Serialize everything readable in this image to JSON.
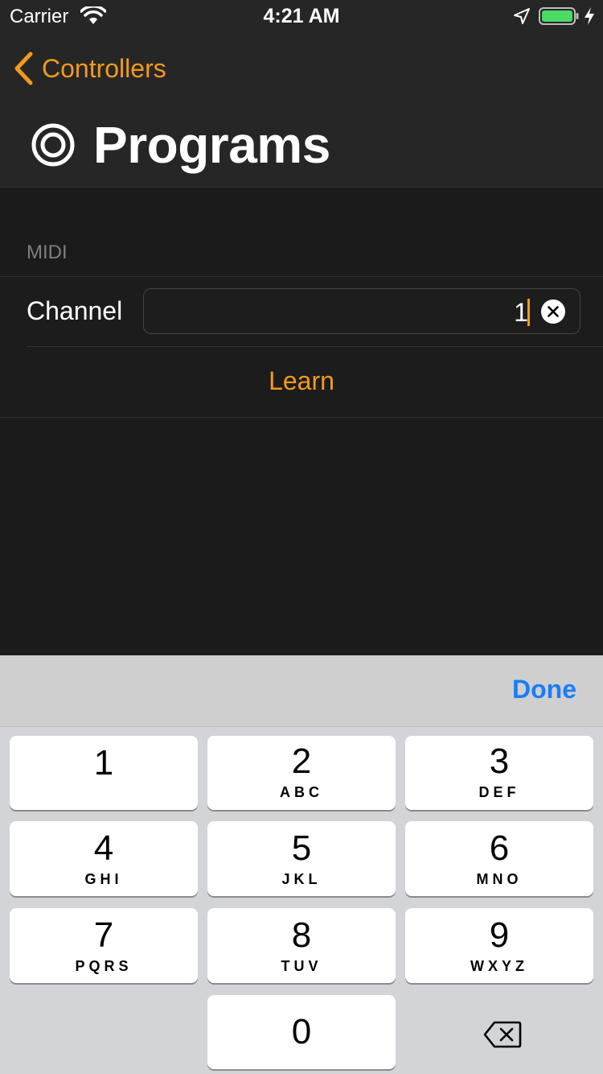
{
  "status_bar": {
    "carrier": "Carrier",
    "time": "4:21 AM"
  },
  "nav": {
    "back_label": "Controllers",
    "title": "Programs"
  },
  "section": {
    "header": "MIDI"
  },
  "channel": {
    "label": "Channel",
    "value": "1"
  },
  "learn_label": "Learn",
  "keyboard": {
    "done_label": "Done",
    "keys": [
      {
        "num": "1",
        "letters": ""
      },
      {
        "num": "2",
        "letters": "ABC"
      },
      {
        "num": "3",
        "letters": "DEF"
      },
      {
        "num": "4",
        "letters": "GHI"
      },
      {
        "num": "5",
        "letters": "JKL"
      },
      {
        "num": "6",
        "letters": "MNO"
      },
      {
        "num": "7",
        "letters": "PQRS"
      },
      {
        "num": "8",
        "letters": "TUV"
      },
      {
        "num": "9",
        "letters": "WXYZ"
      },
      {
        "num": "0",
        "letters": ""
      }
    ]
  },
  "colors": {
    "accent": "#f29a1a",
    "done_blue": "#1a7ef7",
    "battery_green": "#4cd964"
  }
}
